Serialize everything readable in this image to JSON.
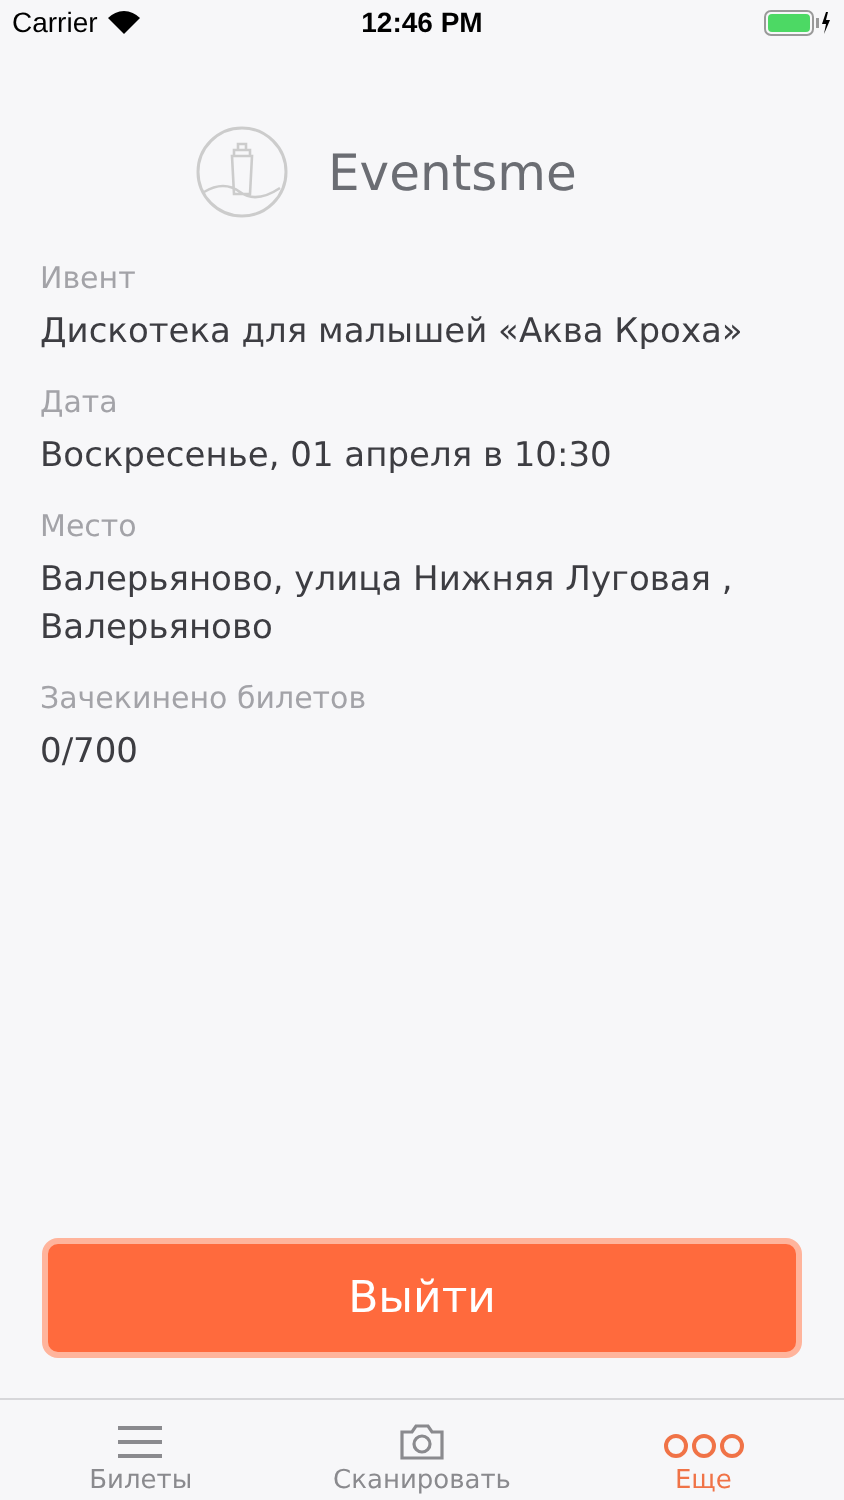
{
  "status_bar": {
    "carrier": "Carrier",
    "time": "12:46 PM"
  },
  "header": {
    "title": "Eventsme"
  },
  "fields": [
    {
      "label": "Ивент",
      "value": "Дискотека для малышей «Аква Кроха»"
    },
    {
      "label": "Дата",
      "value": "Воскресенье, 01 апреля в 10:30"
    },
    {
      "label": "Место",
      "value": "Валерьяново, улица Нижняя Луговая , Валерьяново"
    },
    {
      "label": "Зачекинено билетов",
      "value": "0/700"
    }
  ],
  "logout_button": {
    "label": "Выйти"
  },
  "tabs": [
    {
      "kind": "list",
      "label": "Билеты",
      "selected": false
    },
    {
      "kind": "camera",
      "label": "Сканировать",
      "selected": false
    },
    {
      "kind": "more",
      "label": "Еще",
      "selected": true
    }
  ]
}
